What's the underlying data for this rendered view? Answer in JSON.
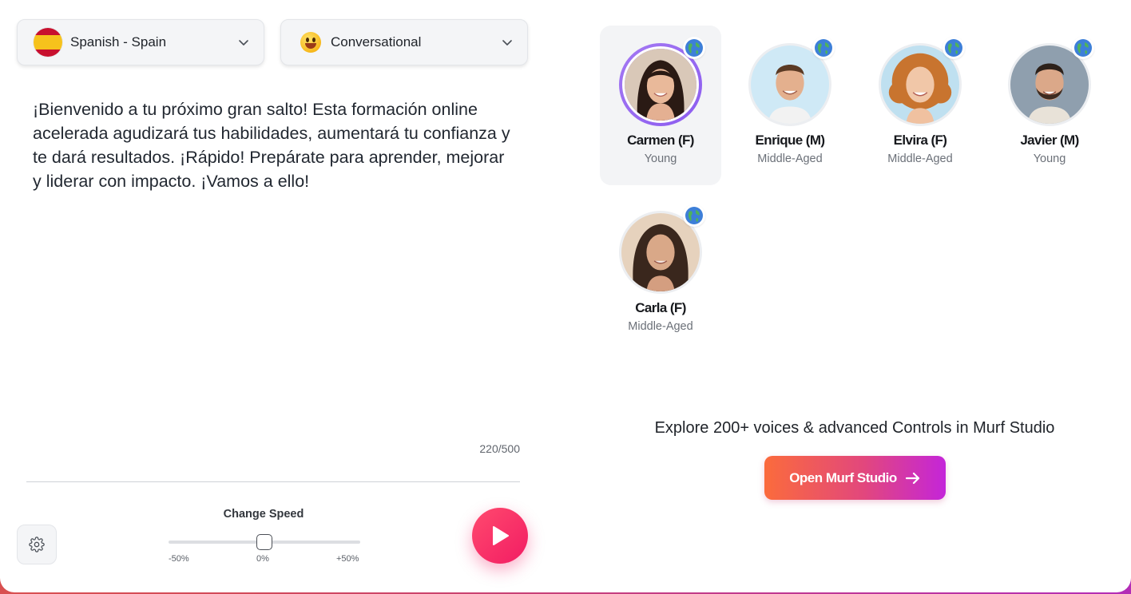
{
  "language_dropdown": {
    "label": "Spanish - Spain",
    "flag_icon": "spain-flag-icon"
  },
  "style_dropdown": {
    "label": "Conversational",
    "icon": "grinning-face-emoji-icon"
  },
  "script": {
    "text": "¡Bienvenido a tu próximo gran salto! Esta formación online acelerada agudizará tus habilidades, aumentará tu confianza y te dará resultados. ¡Rápido! Prepárate para aprender, mejorar y liderar con impacto. ¡Vamos a ello!",
    "char_count": "220/500"
  },
  "speed": {
    "title": "Change Speed",
    "min_label": "-50%",
    "mid_label": "0%",
    "max_label": "+50%",
    "value_percent": 0
  },
  "voices": [
    {
      "name": "Carmen (F)",
      "age": "Young",
      "selected": true
    },
    {
      "name": "Enrique (M)",
      "age": "Middle-Aged",
      "selected": false
    },
    {
      "name": "Elvira (F)",
      "age": "Middle-Aged",
      "selected": false
    },
    {
      "name": "Javier (M)",
      "age": "Young",
      "selected": false
    },
    {
      "name": "Carla (F)",
      "age": "Middle-Aged",
      "selected": false
    }
  ],
  "promo": {
    "text": "Explore 200+ voices & advanced Controls in Murf Studio",
    "button_label": "Open Murf Studio"
  },
  "colors": {
    "accent_pink": "#f21c63",
    "selected_ring": "#8c5cf0",
    "studio_gradient_start": "#fb6b3c",
    "studio_gradient_end": "#c425d9"
  }
}
